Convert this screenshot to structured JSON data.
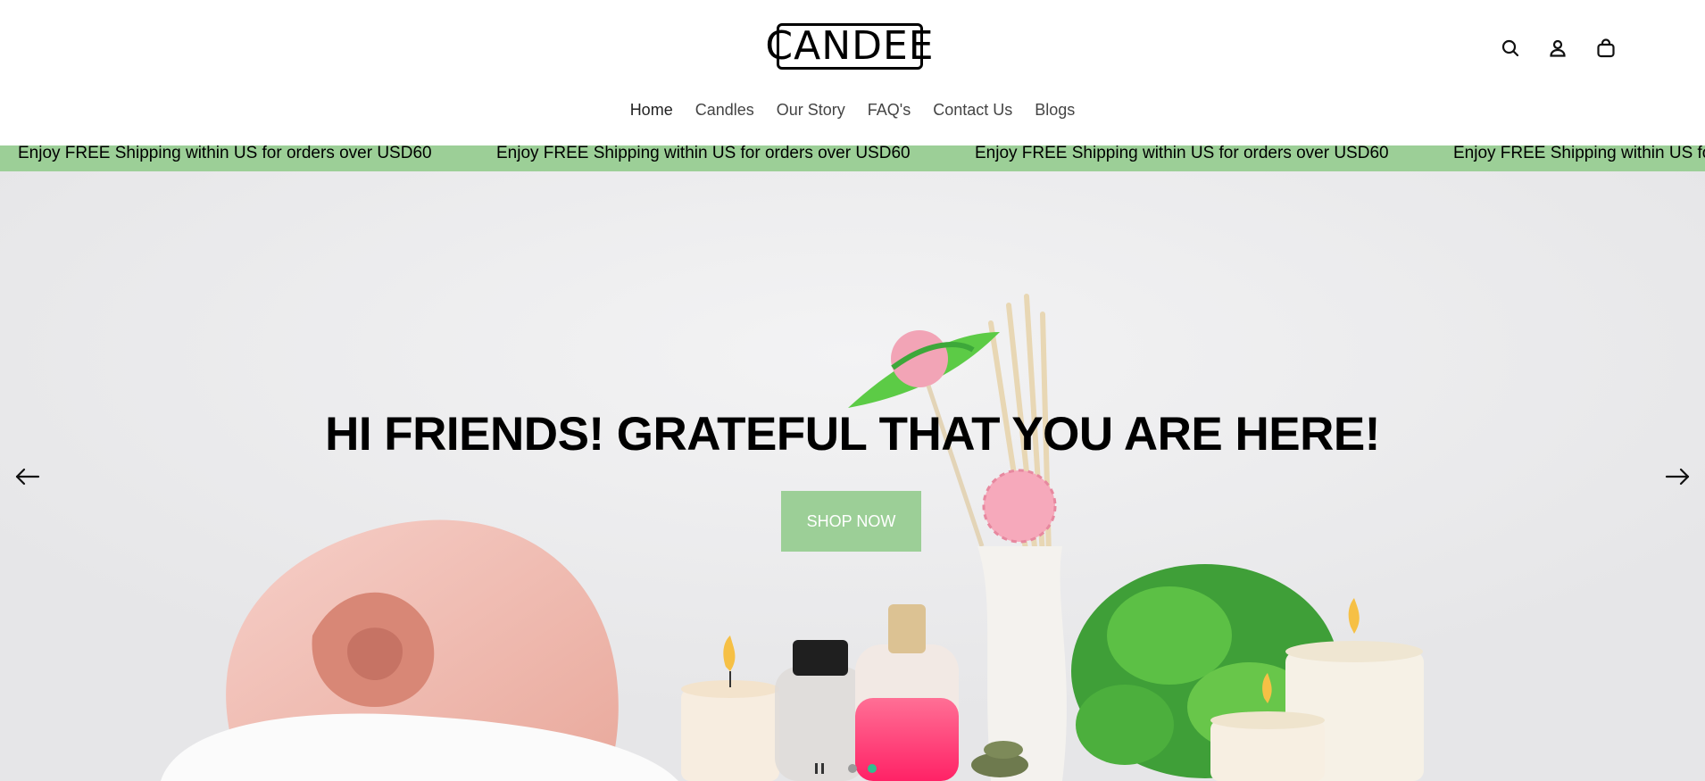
{
  "brand": {
    "logo_text": "CANDEE"
  },
  "nav": {
    "items": [
      {
        "label": "Home",
        "active": true
      },
      {
        "label": "Candles"
      },
      {
        "label": "Our Story"
      },
      {
        "label": "FAQ's"
      },
      {
        "label": "Contact Us"
      },
      {
        "label": "Blogs"
      }
    ]
  },
  "header_icons": [
    "search-icon",
    "account-icon",
    "cart-icon"
  ],
  "announcement": {
    "text": "Enjoy FREE Shipping within US for orders over USD60",
    "background": "#9ccf97"
  },
  "hero": {
    "title": "HI FRIENDS! GRATEFUL THAT YOU ARE HERE!",
    "button_label": "SHOP NOW",
    "button_color": "#9ccf97",
    "slide_count": 2,
    "active_slide": 2,
    "active_dot_color": "#2fbf8f"
  }
}
